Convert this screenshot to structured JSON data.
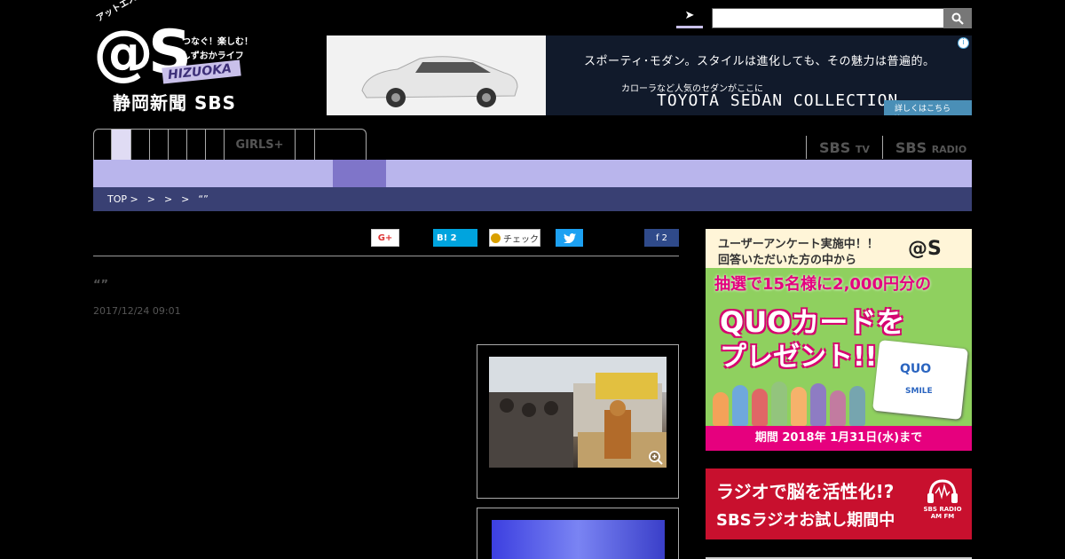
{
  "logo": {
    "kana": "アットエス",
    "mark": "@S",
    "tagline1": "つなぐ！楽しむ！",
    "tagline2": "しずおかライフ",
    "region": "HIZUOKA",
    "publisher": "静岡新聞 SBS"
  },
  "search": {
    "tab_label": "➤",
    "placeholder": "",
    "value": "",
    "button_icon": "search-icon"
  },
  "banner_ad": {
    "headline": "スポーティ･モダン。スタイルは進化しても、その魅力は普遍的。",
    "subline": "カローラなど人気のセダンがここに",
    "brand": "TOYOTA SEDAN COLLECTION",
    "cta": "詳しくはこちら ≫",
    "info": "i"
  },
  "nav": {
    "tabs": [
      {
        "label": "",
        "active": false
      },
      {
        "label": "",
        "active": true
      },
      {
        "label": "",
        "active": false
      },
      {
        "label": "",
        "active": false
      },
      {
        "label": "",
        "active": false
      },
      {
        "label": "",
        "active": false
      },
      {
        "label": "",
        "active": false
      },
      {
        "label": "GIRLS+",
        "active": false
      },
      {
        "label": "",
        "active": false
      },
      {
        "label": "",
        "active": false
      }
    ],
    "sbs_tv": "SBS",
    "sbs_tv_small": "TV",
    "sbs_radio": "SBS",
    "sbs_radio_small": "RADIO"
  },
  "breadcrumb": [
    "TOP >",
    ">",
    ">",
    ">",
    "“”"
  ],
  "social": {
    "gplus": "G+",
    "hatena": "B! 2",
    "mixi": "チェック",
    "tweet": "🐦",
    "facebook": "f  2"
  },
  "article": {
    "title": "“”",
    "date": "2017/12/24 09:01"
  },
  "quo_ad": {
    "line1": "ユーザーアンケート実施中！！",
    "line2": "回答いただいた方の中から",
    "logo": "@S",
    "line3": "抽選で15名様に2,000円分の",
    "line4": "QUOカードを",
    "line5": "プレゼント!!",
    "card_title": "QUO",
    "card_sub": "SMILE",
    "footer": "期間 2018年 1月31日(水)まで"
  },
  "radio_ad": {
    "line1": "ラジオで脳を活性化!?",
    "line2": "SBSラジオお試し期間中",
    "logo": "SBS RADIO AM FM"
  },
  "colors": {
    "sub_bar": "#b9b5ec",
    "sub_active": "#7f75c9",
    "crumb_bar": "#394073"
  }
}
